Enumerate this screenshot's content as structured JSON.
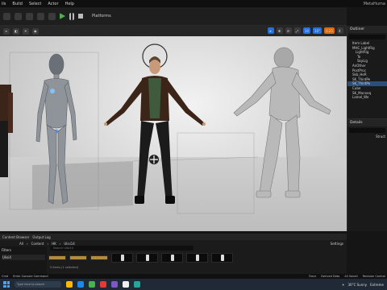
{
  "menubar": {
    "items": [
      "ils",
      "Build",
      "Select",
      "Actor",
      "Help"
    ],
    "project": "MetaHuma"
  },
  "toolbar": {
    "platforms_label": "Platforms"
  },
  "viewport_toolbar": {
    "right_buttons": [
      "10",
      "10°",
      "0.25",
      "4"
    ]
  },
  "outliner": {
    "title": "Outliner",
    "items": [
      "Item Label",
      "MHC_LightRig",
      "LightRig",
      "Te",
      "SkyLig",
      "AnOther",
      "PostProc",
      "Skb_HeR",
      "SK_ThirdPe",
      "SK_ThirdPe",
      "Cube",
      "SK_Manneq",
      "Lamel_We"
    ],
    "selected_index": 9
  },
  "details": {
    "title": "Details",
    "sub": "Struct"
  },
  "content": {
    "tabs": [
      "Content Browser",
      "Output Log"
    ],
    "path": [
      "All",
      "Content",
      "HK",
      "Ulisi14"
    ],
    "settings_label": "Settings",
    "filters_label": "Filters",
    "selected_folder": "Ulisi4",
    "search_placeholder": "Search Ulisi14",
    "item_count": "5 items (1 selected)",
    "assets": [
      "folder",
      "folder",
      "folder",
      "thumb",
      "thumb",
      "thumb",
      "thumb",
      "thumb"
    ]
  },
  "status_bar": {
    "items": [
      "Cmd",
      "Enter Console Command"
    ],
    "right": [
      "Trace",
      "Derived Data",
      "All Saved",
      "Revision Control"
    ]
  },
  "taskbar": {
    "search_placeholder": "Type here to search",
    "weather": "30°C Sunny",
    "tray_time": "Extreme"
  },
  "colors": {
    "accent_blue": "#2a6fd6",
    "play_green": "#4caf50",
    "folder": "#b5893e"
  }
}
